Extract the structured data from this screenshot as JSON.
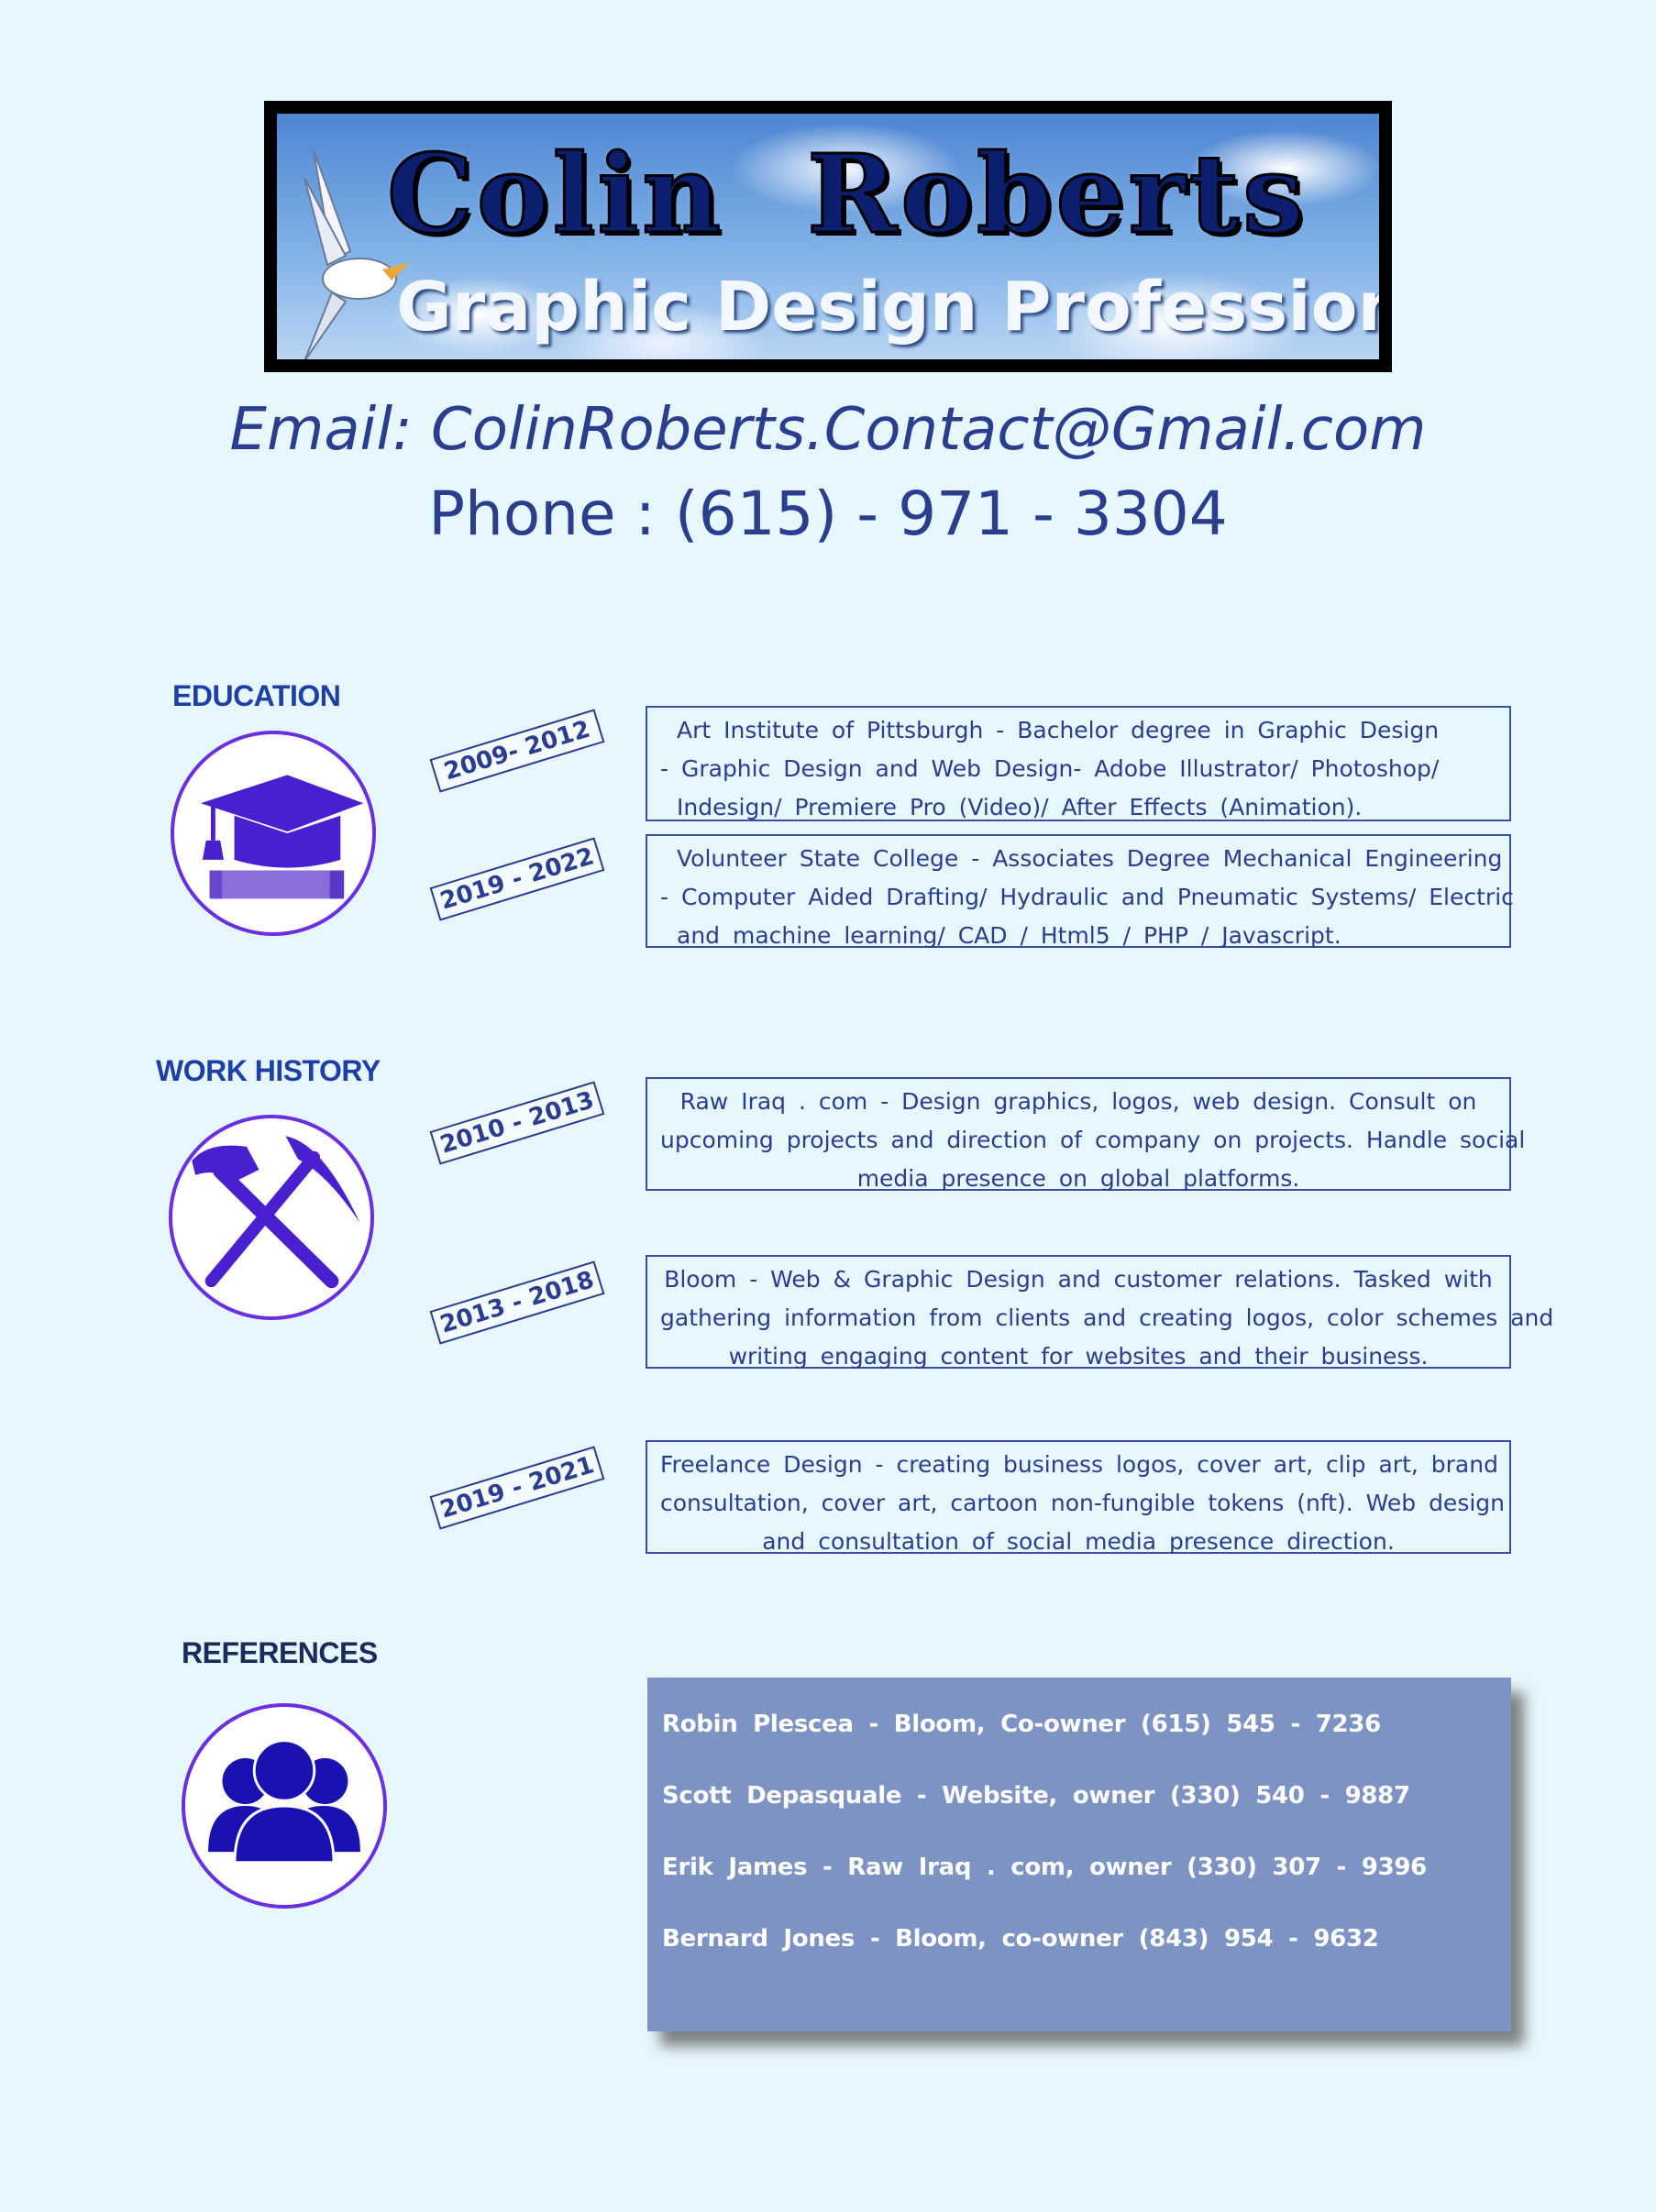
{
  "banner": {
    "name": "Colin  Roberts",
    "subtitle": "Graphic Design Professional"
  },
  "contact": {
    "email": "Email: ColinRoberts.Contact@Gmail.com",
    "phone": "Phone : (615) - 971 - 3304"
  },
  "education": {
    "heading": "EDUCATION",
    "icon": "graduation-cap-icon",
    "entries": [
      {
        "dates": "2009- 2012",
        "lines": [
          "Art Institute of Pittsburgh - Bachelor degree in Graphic Design",
          "- Graphic Design and Web Design- Adobe Illustrator/ Photoshop/",
          "Indesign/ Premiere Pro (Video)/ After Effects (Animation)."
        ]
      },
      {
        "dates": "2019 - 2022",
        "lines": [
          "Volunteer State College - Associates Degree Mechanical Engineering",
          "- Computer Aided Drafting/ Hydraulic and Pneumatic Systems/ Electric",
          "and machine learning/ CAD / Html5 / PHP / Javascript."
        ]
      }
    ]
  },
  "work": {
    "heading": "WORK  HISTORY",
    "icon": "hammer-pickaxe-icon",
    "entries": [
      {
        "dates": "2010 - 2013",
        "lines": [
          "Raw Iraq . com - Design graphics, logos, web design. Consult on",
          "upcoming projects and direction of company on projects. Handle social",
          "media presence on global platforms."
        ]
      },
      {
        "dates": "2013 - 2018",
        "lines": [
          "Bloom - Web & Graphic Design and customer relations. Tasked with",
          "gathering information from clients and creating logos, color schemes and",
          "writing engaging content for websites and their business."
        ]
      },
      {
        "dates": "2019 - 2021",
        "lines": [
          "Freelance Design - creating business logos, cover art, clip art, brand",
          "consultation, cover art, cartoon non-fungible tokens (nft). Web design",
          "and consultation of social media presence direction."
        ]
      }
    ]
  },
  "references": {
    "heading": "REFERENCES",
    "icon": "group-people-icon",
    "items": [
      "Robin Plescea - Bloom, Co-owner (615) 545 - 7236",
      "Scott Depasquale - Website, owner (330) 540 - 9887",
      "Erik James - Raw Iraq . com, owner (330) 307 - 9396",
      "Bernard Jones - Bloom, co-owner (843) 954 - 9632"
    ]
  },
  "colors": {
    "background": "#e6f7fd",
    "text": "#2a3d8f",
    "icon_purple": "#6a2fe0",
    "references_box": "#7c93c4"
  }
}
